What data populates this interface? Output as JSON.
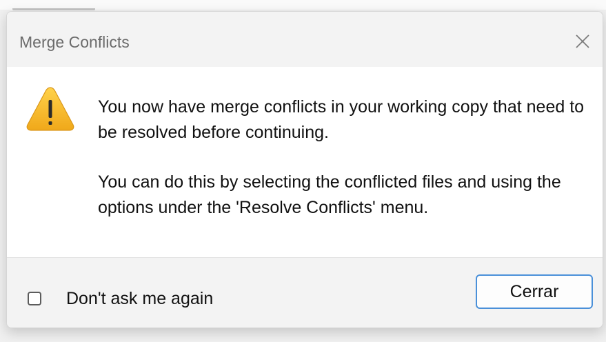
{
  "dialog": {
    "title": "Merge Conflicts",
    "message_line_1": "You now have merge conflicts in your working copy that need to be resolved before continuing.",
    "message_line_2": "You can do this by selecting the conflicted files and using the options under the 'Resolve Conflicts' menu.",
    "icon": "warning-icon",
    "close_icon": "close-icon"
  },
  "footer": {
    "checkbox_label": "Don't ask me again",
    "checkbox_checked": false,
    "button_label": "Cerrar"
  },
  "colors": {
    "accent": "#4a90d9",
    "warning": "#f2b824"
  }
}
